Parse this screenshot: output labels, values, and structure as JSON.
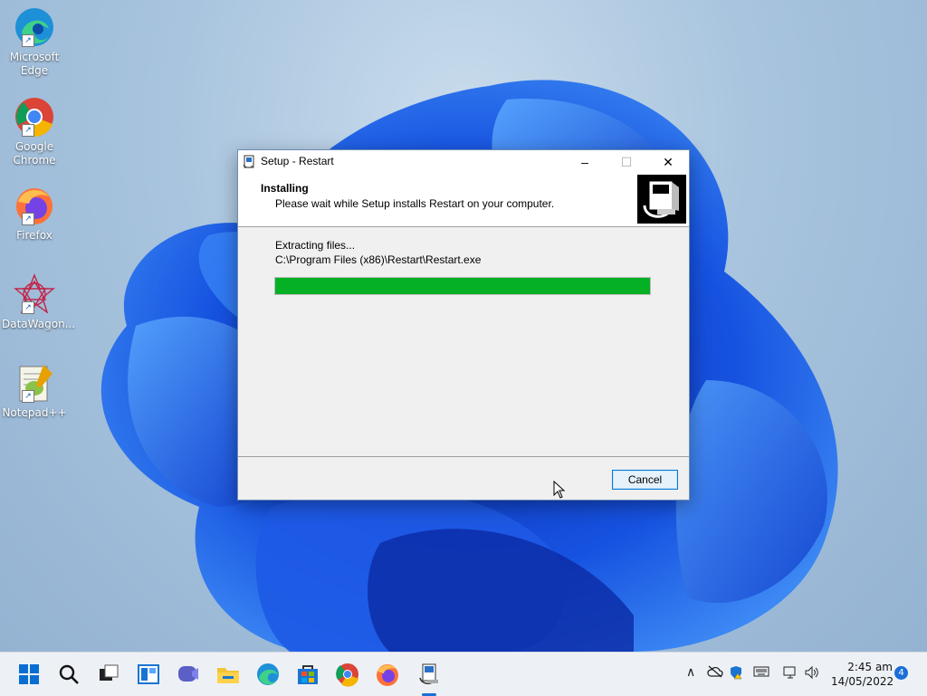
{
  "desktop": {
    "icons": [
      {
        "label_1": "Microsoft",
        "label_2": "Edge",
        "icon": "edge-icon"
      },
      {
        "label_1": "Google",
        "label_2": "Chrome",
        "icon": "chrome-icon"
      },
      {
        "label_1": "Firefox",
        "icon": "firefox-icon"
      },
      {
        "label_1": "DataWagon...",
        "icon": "datawagon-icon"
      },
      {
        "label_1": "Notepad++",
        "icon": "notepadpp-icon"
      }
    ]
  },
  "dialog": {
    "title": "Setup - Restart",
    "header_title": "Installing",
    "header_subtitle": "Please wait while Setup installs Restart on your computer.",
    "status": "Extracting files...",
    "file_path": "C:\\Program Files (x86)\\Restart\\Restart.exe",
    "progress": 1.0,
    "cancel_label": "Cancel",
    "window_controls": {
      "minimize": "–",
      "maximize": "☐",
      "close": "✕"
    }
  },
  "taskbar": {
    "time": "2:45 am",
    "date": "14/05/2022",
    "notification_count": "4",
    "apps": [
      "start-icon",
      "search-icon",
      "task-view-icon",
      "widgets-icon",
      "chat-icon",
      "file-explorer-icon",
      "edge-icon",
      "store-icon",
      "chrome-icon",
      "firefox-icon",
      "setup-icon"
    ]
  },
  "colors": {
    "progress": "#06b025",
    "accent": "#0078d7"
  }
}
